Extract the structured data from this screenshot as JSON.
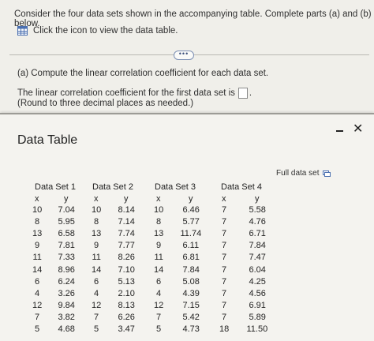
{
  "question": {
    "intro": "Consider the four data sets shown in the accompanying table. Complete parts (a) and (b) below.",
    "table_link": "Click the icon to view the data table.",
    "more_label": "•••",
    "part_a": "(a) Compute the linear correlation coefficient for each data set.",
    "corr_prompt": "The linear correlation coefficient for the first data set is",
    "corr_suffix": ".",
    "round_note": "(Round to three decimal places as needed.)",
    "answer_value": ""
  },
  "modal": {
    "title": "Data Table",
    "full_data_set": "Full data set",
    "minimize_glyph": "-",
    "close_glyph": "✕"
  },
  "data_table": {
    "set_labels": [
      "Data Set 1",
      "Data Set 2",
      "Data Set 3",
      "Data Set 4"
    ],
    "col_labels": [
      "x",
      "y",
      "x",
      "y",
      "x",
      "y",
      "x",
      "y"
    ],
    "rows": [
      [
        "10",
        "7.04",
        "10",
        "8.14",
        "10",
        "6.46",
        "7",
        "5.58"
      ],
      [
        "8",
        "5.95",
        "8",
        "7.14",
        "8",
        "5.77",
        "7",
        "4.76"
      ],
      [
        "13",
        "6.58",
        "13",
        "7.74",
        "13",
        "11.74",
        "7",
        "6.71"
      ],
      [
        "9",
        "7.81",
        "9",
        "7.77",
        "9",
        "6.11",
        "7",
        "7.84"
      ],
      [
        "11",
        "7.33",
        "11",
        "8.26",
        "11",
        "6.81",
        "7",
        "7.47"
      ],
      [
        "14",
        "8.96",
        "14",
        "7.10",
        "14",
        "7.84",
        "7",
        "6.04"
      ],
      [
        "6",
        "6.24",
        "6",
        "5.13",
        "6",
        "5.08",
        "7",
        "4.25"
      ],
      [
        "4",
        "3.26",
        "4",
        "2.10",
        "4",
        "4.39",
        "7",
        "4.56"
      ],
      [
        "12",
        "9.84",
        "12",
        "8.13",
        "12",
        "7.15",
        "7",
        "6.91"
      ],
      [
        "7",
        "3.82",
        "7",
        "6.26",
        "7",
        "5.42",
        "7",
        "5.89"
      ],
      [
        "5",
        "4.68",
        "5",
        "3.47",
        "5",
        "4.73",
        "18",
        "11.50"
      ]
    ]
  }
}
